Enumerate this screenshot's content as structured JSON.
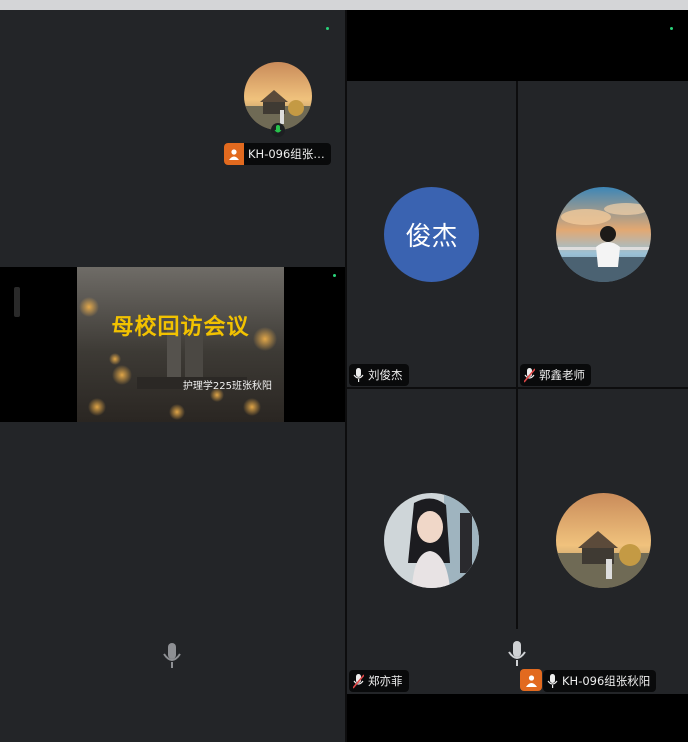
{
  "presenter": {
    "name": "KH-096组张…",
    "slide_title": "母校回访会议",
    "slide_subtitle": "护理学225班张秋阳"
  },
  "participants": [
    {
      "id": "liu",
      "name": "刘俊杰",
      "initials": "俊杰",
      "avatar_color": "#3a63b1",
      "mic": "on"
    },
    {
      "id": "guo",
      "name": "郭鑫老师",
      "mic": "muted"
    },
    {
      "id": "zheng",
      "name": "郑亦菲",
      "mic": "muted"
    },
    {
      "id": "kh096",
      "name": "KH-096组张秋阳",
      "mic": "on"
    }
  ],
  "icons": [
    "user-badge-icon",
    "microphone-icon",
    "mic-muted-icon",
    "speaking-indicator-icon",
    "presenter-badge-icon"
  ],
  "colors": {
    "accent_orange": "#e26a1f",
    "speaking_green": "#27c24c",
    "status_green": "#29d27a",
    "muted_red": "#e04848",
    "slide_title_yellow": "#f2c200"
  }
}
